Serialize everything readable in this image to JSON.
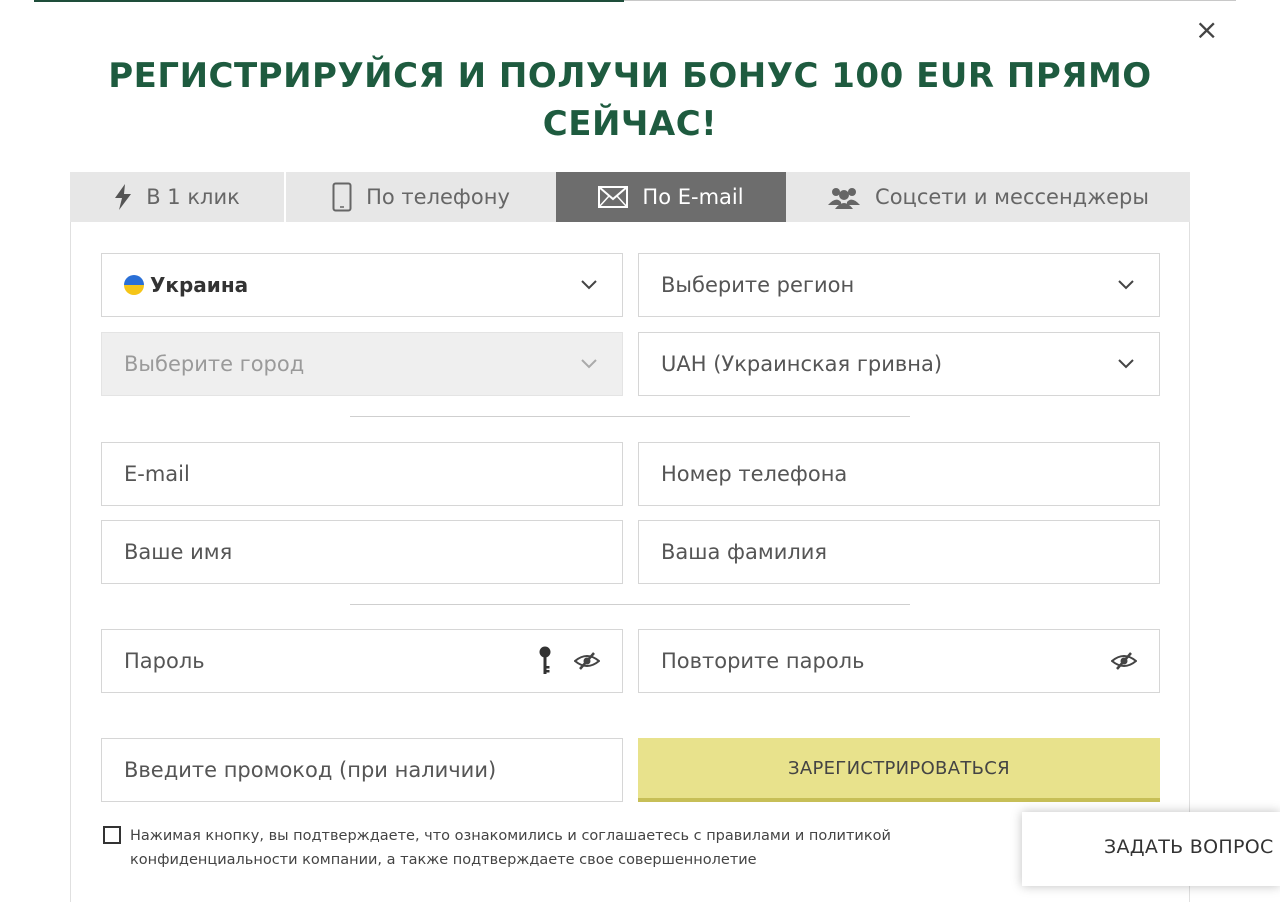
{
  "modal": {
    "close_glyph": "×",
    "title": "РЕГИСТРИРУЙСЯ И ПОЛУЧИ БОНУС 100 EUR ПРЯМО СЕЙЧАС!"
  },
  "tabs": [
    {
      "label": "В 1 клик",
      "icon": "lightning-icon",
      "active": false
    },
    {
      "label": "По телефону",
      "icon": "phone-icon",
      "active": false
    },
    {
      "label": "По E-mail",
      "icon": "envelope-icon",
      "active": true
    },
    {
      "label": "Соцсети и мессенджеры",
      "icon": "users-icon",
      "active": false
    }
  ],
  "form": {
    "country": {
      "value": "Украина",
      "flag_colors": [
        "#2a6fd6",
        "#f5c518"
      ]
    },
    "region": {
      "placeholder": "Выберите регион"
    },
    "city": {
      "placeholder": "Выберите город",
      "disabled": true
    },
    "currency": {
      "value": "UAH (Украинская гривна)"
    },
    "email": {
      "placeholder": "E-mail"
    },
    "phone": {
      "placeholder": "Номер телефона"
    },
    "first_name": {
      "placeholder": "Ваше имя"
    },
    "last_name": {
      "placeholder": "Ваша фамилия"
    },
    "password": {
      "placeholder": "Пароль"
    },
    "password_repeat": {
      "placeholder": "Повторите пароль"
    },
    "promo": {
      "placeholder": "Введите промокод (при наличии)"
    },
    "register_button": "ЗАРЕГИСТРИРОВАТЬСЯ",
    "consent_text": "Нажимая кнопку, вы подтверждаете, что ознакомились и соглашаетесь с правилами и политикой конфиденциальности компании, а также подтверждаете свое совершеннолетие"
  },
  "support": {
    "ask_label": "ЗАДАТЬ ВОПРОС"
  },
  "colors": {
    "title": "#1e5b3f",
    "active_tab": "#6d6d6d",
    "register_button": "#e8e28c"
  }
}
